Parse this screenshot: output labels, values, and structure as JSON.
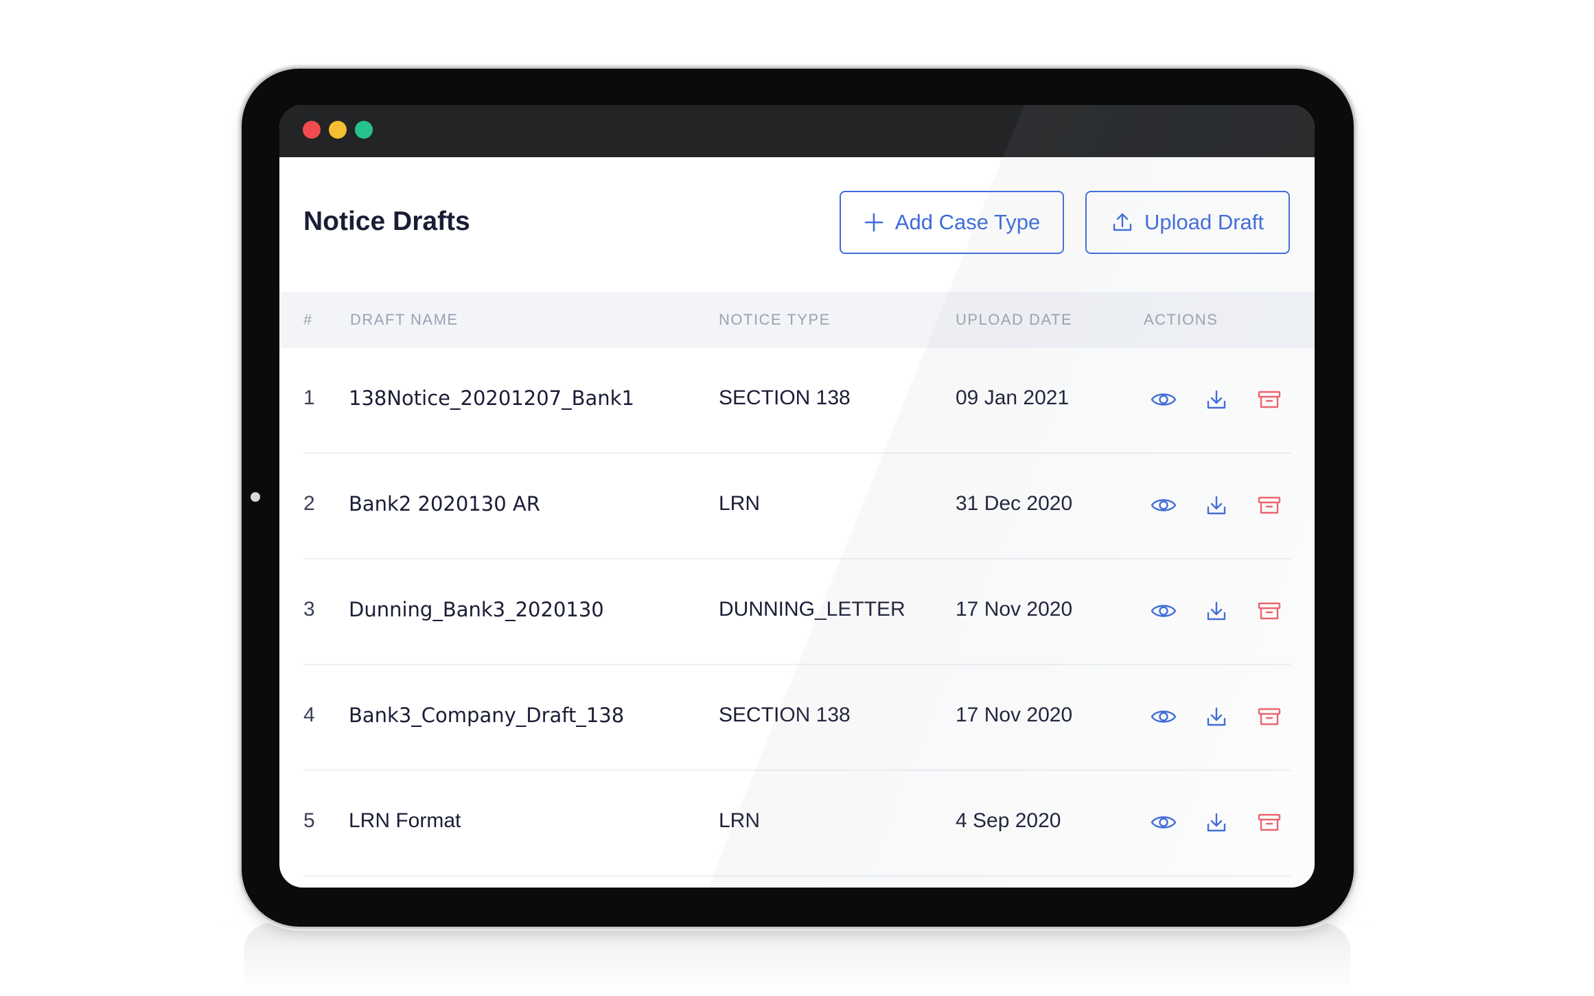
{
  "window": {
    "controls": [
      "close",
      "minimize",
      "maximize"
    ]
  },
  "page": {
    "title": "Notice Drafts"
  },
  "toolbar": {
    "add_label": "Add Case Type",
    "add_icon": "plus-icon",
    "upload_label": "Upload Draft",
    "upload_icon": "upload-icon"
  },
  "table": {
    "columns": [
      "#",
      "DRAFT NAME",
      "NOTICE TYPE",
      "UPLOAD DATE",
      "ACTIONS"
    ],
    "rows": [
      {
        "index": "1",
        "name": "138Notice_20201207_Bank1",
        "type": "SECTION 138",
        "date": "09 Jan 2021"
      },
      {
        "index": "2",
        "name": "Bank2 2020130 AR",
        "type": "LRN",
        "date": "31 Dec 2020"
      },
      {
        "index": "3",
        "name": "Dunning_Bank3_2020130",
        "type": "DUNNING_LETTER",
        "date": "17 Nov 2020"
      },
      {
        "index": "4",
        "name": "Bank3_Company_Draft_138",
        "type": "SECTION 138",
        "date": "17 Nov 2020"
      },
      {
        "index": "5",
        "name": "LRN Format",
        "type": "LRN",
        "date": "4 Sep 2020"
      }
    ],
    "row_actions": [
      "eye-icon",
      "download-icon",
      "archive-icon"
    ]
  },
  "colors": {
    "accent": "#3d6bdb",
    "danger": "#f0606a",
    "title_text": "#1a1d35",
    "header_bg": "#f2f4f8",
    "titlebar_bg": "#222426"
  }
}
